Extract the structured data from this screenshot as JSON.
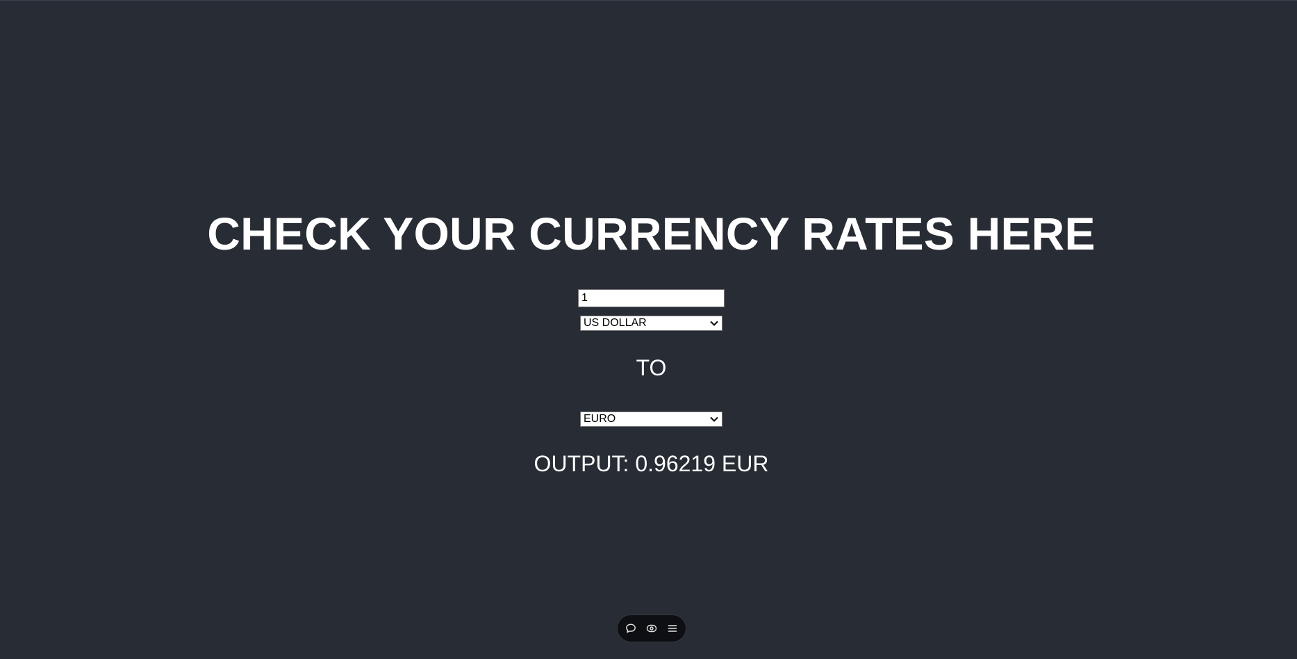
{
  "header": {
    "title": "CHECK YOUR CURRENCY RATES HERE"
  },
  "converter": {
    "amount": "1",
    "from_currency": "US DOLLAR",
    "to_label": "TO",
    "to_currency": "EURO",
    "output_label": "OUTPUT:",
    "output_value": "0.96219",
    "output_code": "EUR"
  },
  "toolbar": {
    "icons": [
      "comment-icon",
      "eye-icon",
      "menu-icon"
    ]
  },
  "colors": {
    "background": "#282c34",
    "text": "#ffffff",
    "toolbar_background": "#0d0f12"
  }
}
